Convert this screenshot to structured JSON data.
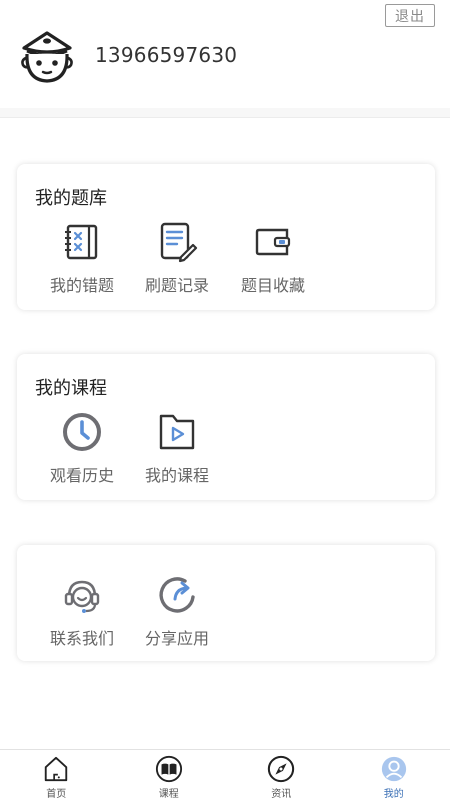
{
  "header": {
    "logout_label": "退出",
    "phone": "13966597630"
  },
  "cards": {
    "question_bank": {
      "title": "我的题库",
      "items": [
        {
          "label": "我的错题",
          "icon": "wrong-questions-notebook-icon"
        },
        {
          "label": "刷题记录",
          "icon": "practice-record-edit-icon"
        },
        {
          "label": "题目收藏",
          "icon": "favorites-wallet-icon"
        }
      ]
    },
    "courses": {
      "title": "我的课程",
      "items": [
        {
          "label": "观看历史",
          "icon": "clock-history-icon"
        },
        {
          "label": "我的课程",
          "icon": "video-folder-icon"
        }
      ]
    },
    "other": {
      "items": [
        {
          "label": "联系我们",
          "icon": "headset-support-icon"
        },
        {
          "label": "分享应用",
          "icon": "share-arrow-icon"
        }
      ]
    }
  },
  "tabbar": {
    "tabs": [
      {
        "label": "首页",
        "icon": "home-icon"
      },
      {
        "label": "课程",
        "icon": "book-icon"
      },
      {
        "label": "资讯",
        "icon": "compass-icon"
      },
      {
        "label": "我的",
        "icon": "user-profile-icon",
        "active": true
      }
    ]
  },
  "colors": {
    "accent": "#3a6fb5",
    "icon_blue": "#5b8fd6",
    "icon_dark": "#333333",
    "icon_gray": "#6e6e73"
  }
}
